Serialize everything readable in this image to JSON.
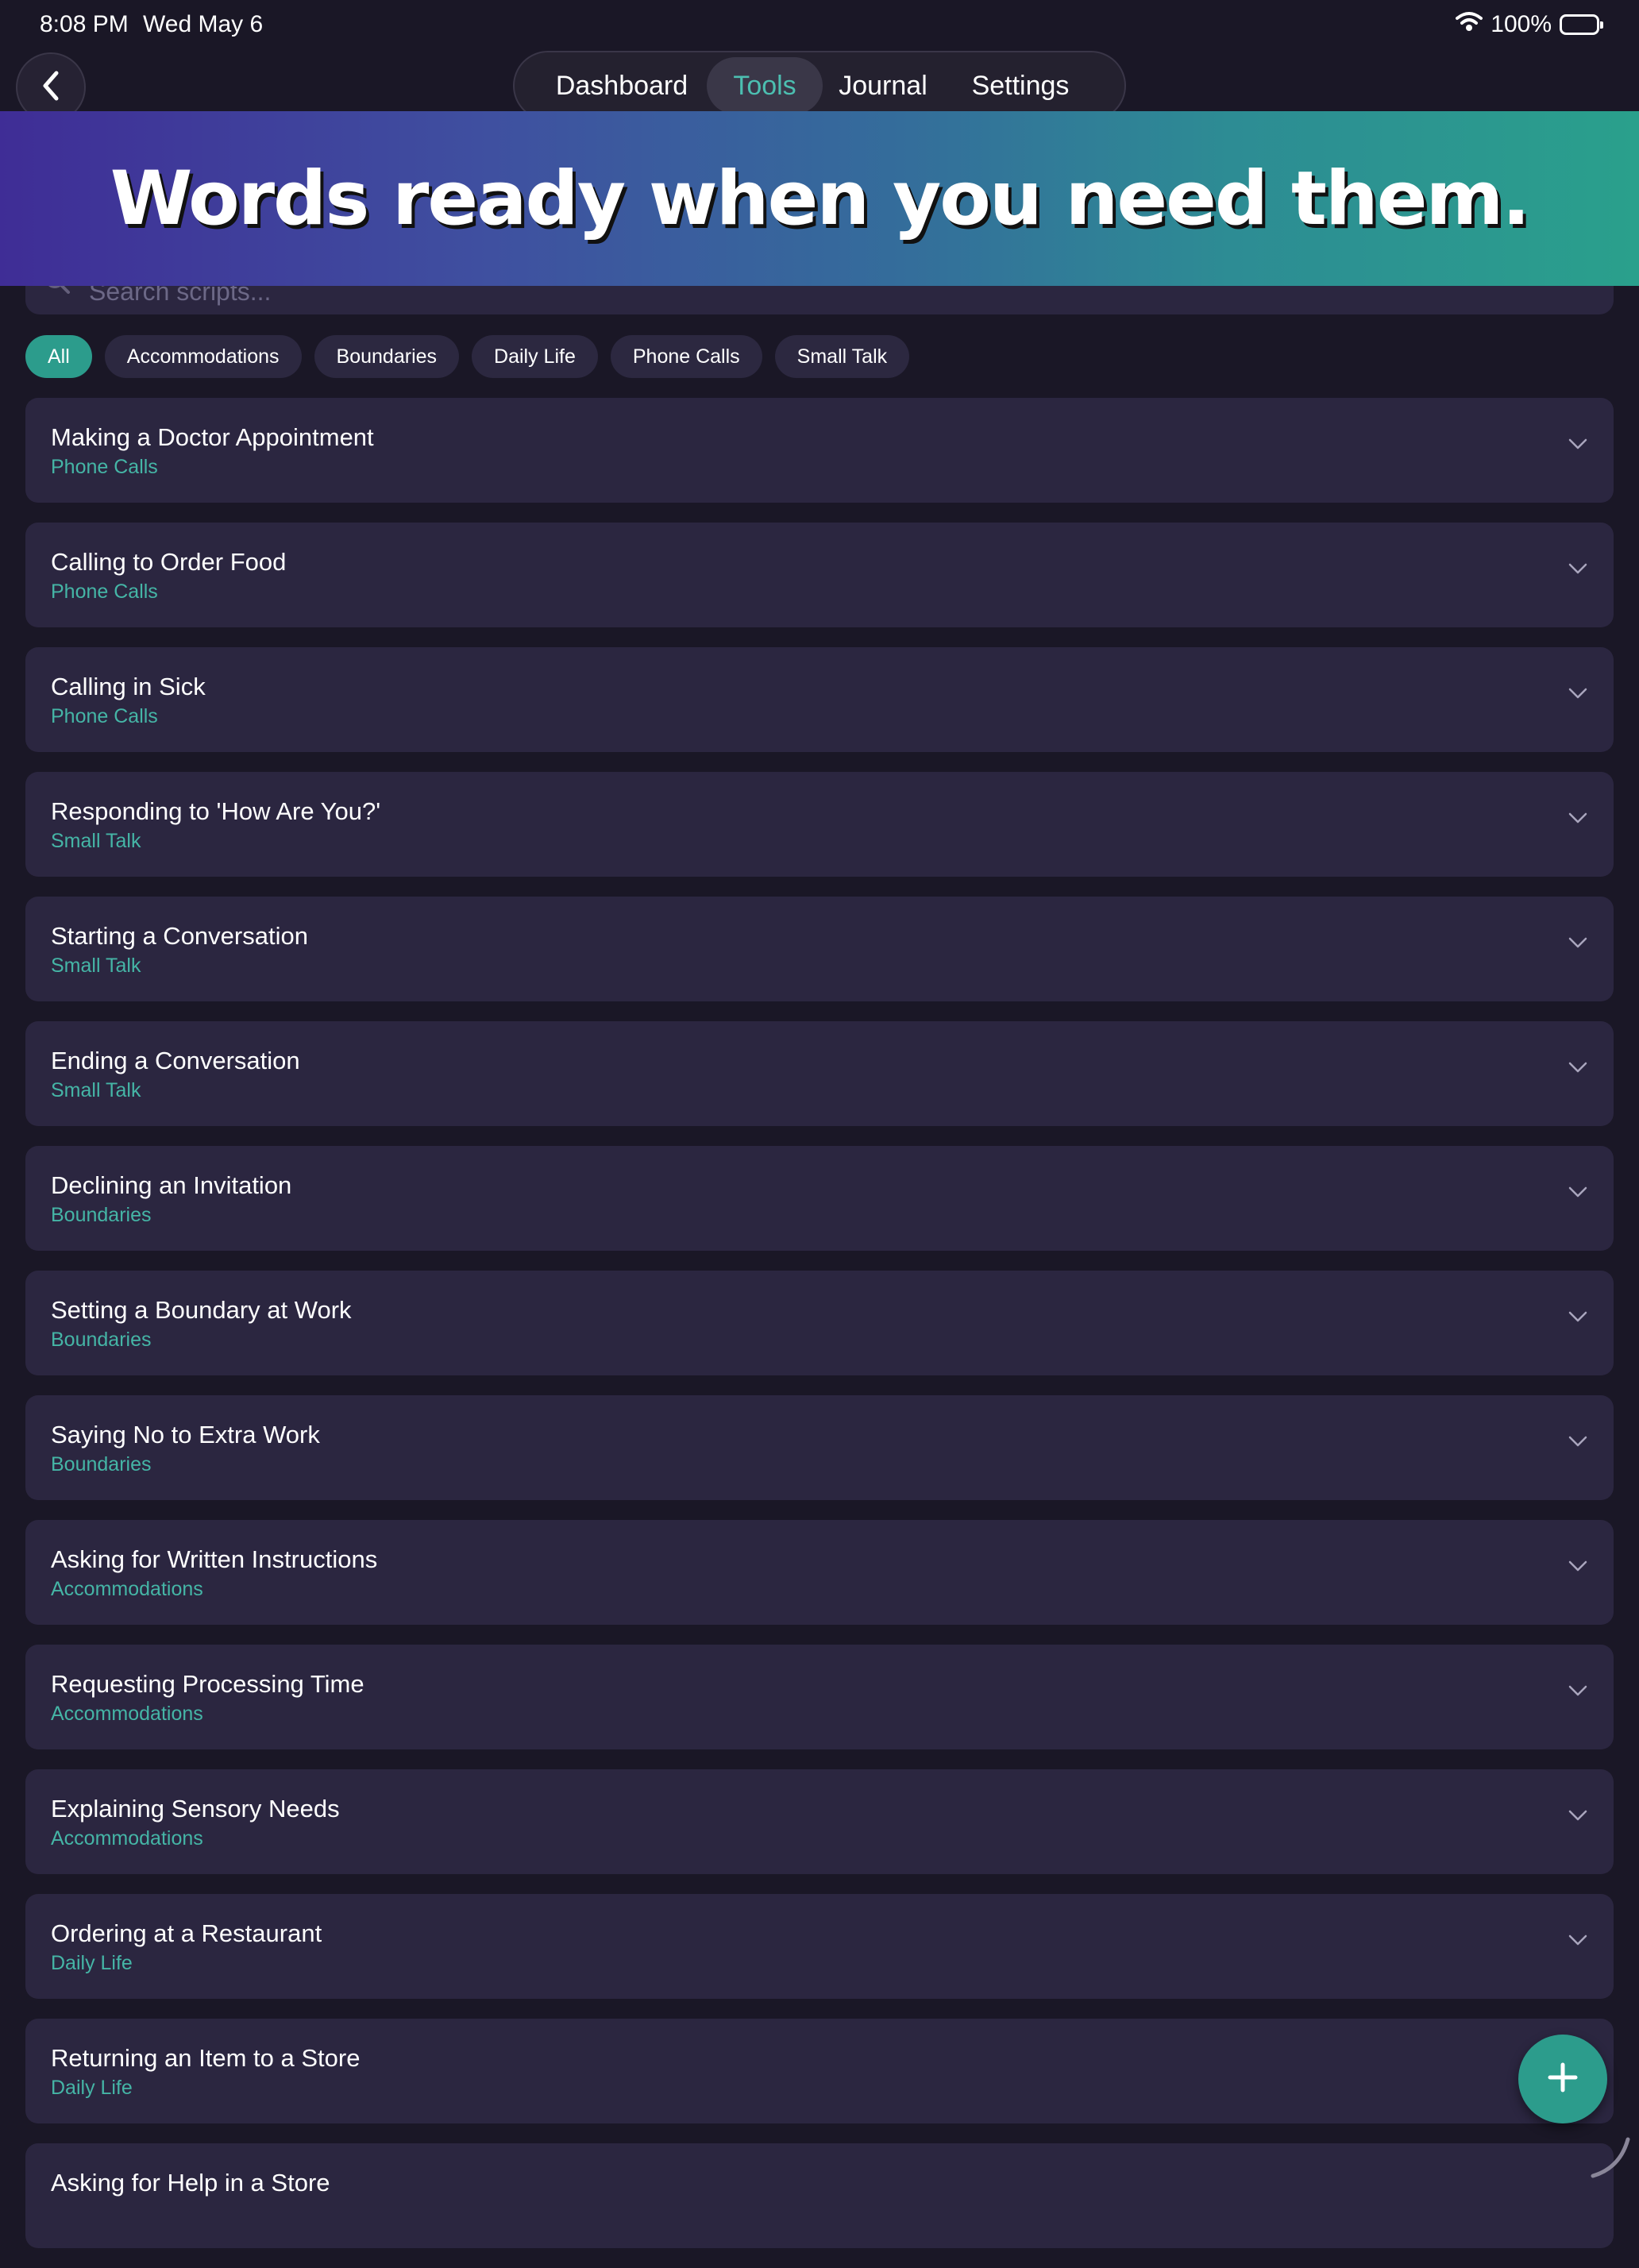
{
  "status_bar": {
    "time": "8:08 PM",
    "date": "Wed May 6",
    "battery": "100%"
  },
  "nav": {
    "tabs": [
      "Dashboard",
      "Tools",
      "Journal",
      "Settings"
    ],
    "active_tab": "Tools"
  },
  "banner": {
    "text": "Words ready when you need them."
  },
  "search": {
    "placeholder": "Search scripts..."
  },
  "filters": {
    "chips": [
      "All",
      "Accommodations",
      "Boundaries",
      "Daily Life",
      "Phone Calls",
      "Small Talk"
    ],
    "active": "All"
  },
  "scripts": [
    {
      "title": "Making a Doctor Appointment",
      "category": "Phone Calls"
    },
    {
      "title": "Calling to Order Food",
      "category": "Phone Calls"
    },
    {
      "title": "Calling in Sick",
      "category": "Phone Calls"
    },
    {
      "title": "Responding to 'How Are You?'",
      "category": "Small Talk"
    },
    {
      "title": "Starting a Conversation",
      "category": "Small Talk"
    },
    {
      "title": "Ending a Conversation",
      "category": "Small Talk"
    },
    {
      "title": "Declining an Invitation",
      "category": "Boundaries"
    },
    {
      "title": "Setting a Boundary at Work",
      "category": "Boundaries"
    },
    {
      "title": "Saying No to Extra Work",
      "category": "Boundaries"
    },
    {
      "title": "Asking for Written Instructions",
      "category": "Accommodations"
    },
    {
      "title": "Requesting Processing Time",
      "category": "Accommodations"
    },
    {
      "title": "Explaining Sensory Needs",
      "category": "Accommodations"
    },
    {
      "title": "Ordering at a Restaurant",
      "category": "Daily Life"
    },
    {
      "title": "Returning an Item to a Store",
      "category": "Daily Life"
    },
    {
      "title": "Asking for Help in a Store",
      "category": ""
    }
  ],
  "colors": {
    "background": "#1a1726",
    "card": "#2b2640",
    "accent": "#2c9c8c",
    "category_text": "#45b5a6"
  },
  "icons": {
    "back": "chevron-left-icon",
    "wifi": "wifi-icon",
    "battery": "battery-icon",
    "search": "search-icon",
    "expand": "chevron-down-icon",
    "add": "plus-icon"
  }
}
